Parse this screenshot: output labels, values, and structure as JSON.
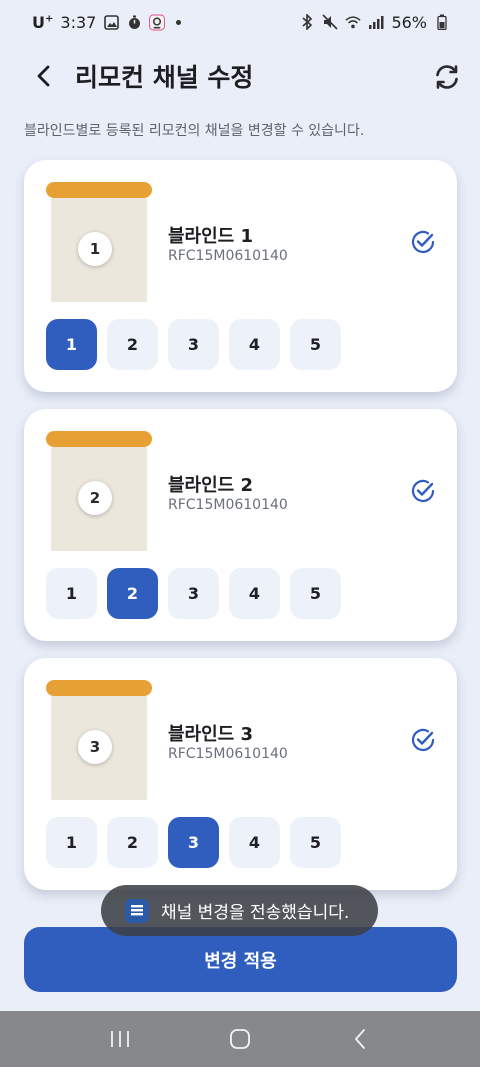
{
  "status_bar": {
    "carrier": "U",
    "carrier_sup": "+",
    "time": "3:37",
    "battery": "56%",
    "icons": [
      "gallery-icon",
      "timer-icon",
      "app-notification-icon",
      "dot-icon",
      "bluetooth-icon",
      "mute-icon",
      "wifi-icon",
      "signal-icon",
      "battery-icon"
    ]
  },
  "header": {
    "title": "리모컨 채널 수정",
    "back_icon": "chevron-left-icon",
    "refresh_icon": "refresh-icon"
  },
  "subtitle": "블라인드별로 등록된 리모컨의 채널을 변경할 수 있습니다.",
  "blinds": [
    {
      "number": "1",
      "name": "블라인드 1",
      "serial": "RFC15M0610140",
      "selected_channel": "1",
      "checked": true
    },
    {
      "number": "2",
      "name": "블라인드 2",
      "serial": "RFC15M0610140",
      "selected_channel": "2",
      "checked": true
    },
    {
      "number": "3",
      "name": "블라인드 3",
      "serial": "RFC15M0610140",
      "selected_channel": "3",
      "checked": true
    }
  ],
  "channels": [
    "1",
    "2",
    "3",
    "4",
    "5"
  ],
  "toast": {
    "text": "채널 변경을 전송했습니다.",
    "icon": "app-icon"
  },
  "apply_button": "변경 적용",
  "nav_bar": {
    "icons": [
      "recent-apps-icon",
      "home-icon",
      "back-icon"
    ]
  },
  "colors": {
    "background": "#e9eef8",
    "accent": "#2f5ebf",
    "rail": "#e7a033",
    "shade": "#ece7dd",
    "channel_idle": "#edf1f9",
    "check": "#2f5ebf"
  }
}
